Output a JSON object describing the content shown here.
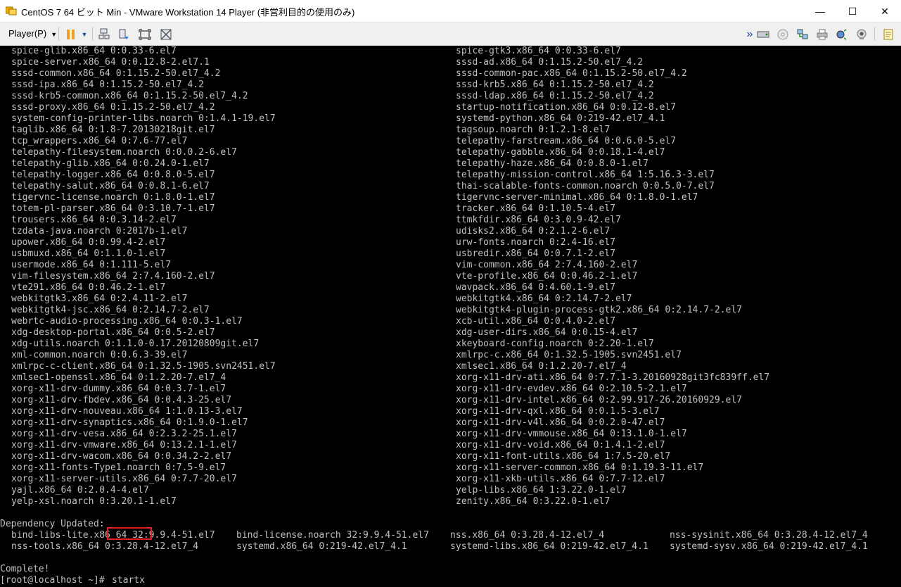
{
  "window": {
    "title": "CentOS 7 64 ビット Min - VMware Workstation 14 Player (非営利目的の使用のみ)",
    "minimize_label": "—",
    "maximize_label": "☐",
    "close_label": "✕"
  },
  "toolbar": {
    "player_menu_label": "Player(P)",
    "player_menu_caret": "▼",
    "pause_caret": "▼",
    "expand_label": "»"
  },
  "terminal": {
    "left_column": [
      "spice-glib.x86_64 0:0.33-6.el7",
      "spice-server.x86_64 0:0.12.8-2.el7.1",
      "sssd-common.x86_64 0:1.15.2-50.el7_4.2",
      "sssd-ipa.x86_64 0:1.15.2-50.el7_4.2",
      "sssd-krb5-common.x86_64 0:1.15.2-50.el7_4.2",
      "sssd-proxy.x86_64 0:1.15.2-50.el7_4.2",
      "system-config-printer-libs.noarch 0:1.4.1-19.el7",
      "taglib.x86_64 0:1.8-7.20130218git.el7",
      "tcp_wrappers.x86_64 0:7.6-77.el7",
      "telepathy-filesystem.noarch 0:0.0.2-6.el7",
      "telepathy-glib.x86_64 0:0.24.0-1.el7",
      "telepathy-logger.x86_64 0:0.8.0-5.el7",
      "telepathy-salut.x86_64 0:0.8.1-6.el7",
      "tigervnc-license.noarch 0:1.8.0-1.el7",
      "totem-pl-parser.x86_64 0:3.10.7-1.el7",
      "trousers.x86_64 0:0.3.14-2.el7",
      "tzdata-java.noarch 0:2017b-1.el7",
      "upower.x86_64 0:0.99.4-2.el7",
      "usbmuxd.x86_64 0:1.1.0-1.el7",
      "usermode.x86_64 0:1.111-5.el7",
      "vim-filesystem.x86_64 2:7.4.160-2.el7",
      "vte291.x86_64 0:0.46.2-1.el7",
      "webkitgtk3.x86_64 0:2.4.11-2.el7",
      "webkitgtk4-jsc.x86_64 0:2.14.7-2.el7",
      "webrtc-audio-processing.x86_64 0:0.3-1.el7",
      "xdg-desktop-portal.x86_64 0:0.5-2.el7",
      "xdg-utils.noarch 0:1.1.0-0.17.20120809git.el7",
      "xml-common.noarch 0:0.6.3-39.el7",
      "xmlrpc-c-client.x86_64 0:1.32.5-1905.svn2451.el7",
      "xmlsec1-openssl.x86_64 0:1.2.20-7.el7_4",
      "xorg-x11-drv-dummy.x86_64 0:0.3.7-1.el7",
      "xorg-x11-drv-fbdev.x86_64 0:0.4.3-25.el7",
      "xorg-x11-drv-nouveau.x86_64 1:1.0.13-3.el7",
      "xorg-x11-drv-synaptics.x86_64 0:1.9.0-1.el7",
      "xorg-x11-drv-vesa.x86_64 0:2.3.2-25.1.el7",
      "xorg-x11-drv-vmware.x86_64 0:13.2.1-1.el7",
      "xorg-x11-drv-wacom.x86_64 0:0.34.2-2.el7",
      "xorg-x11-fonts-Type1.noarch 0:7.5-9.el7",
      "xorg-x11-server-utils.x86_64 0:7.7-20.el7",
      "yajl.x86_64 0:2.0.4-4.el7",
      "yelp-xsl.noarch 0:3.20.1-1.el7"
    ],
    "right_column": [
      "spice-gtk3.x86_64 0:0.33-6.el7",
      "sssd-ad.x86_64 0:1.15.2-50.el7_4.2",
      "sssd-common-pac.x86_64 0:1.15.2-50.el7_4.2",
      "sssd-krb5.x86_64 0:1.15.2-50.el7_4.2",
      "sssd-ldap.x86_64 0:1.15.2-50.el7_4.2",
      "startup-notification.x86_64 0:0.12-8.el7",
      "systemd-python.x86_64 0:219-42.el7_4.1",
      "tagsoup.noarch 0:1.2.1-8.el7",
      "telepathy-farstream.x86_64 0:0.6.0-5.el7",
      "telepathy-gabble.x86_64 0:0.18.1-4.el7",
      "telepathy-haze.x86_64 0:0.8.0-1.el7",
      "telepathy-mission-control.x86_64 1:5.16.3-3.el7",
      "thai-scalable-fonts-common.noarch 0:0.5.0-7.el7",
      "tigervnc-server-minimal.x86_64 0:1.8.0-1.el7",
      "tracker.x86_64 0:1.10.5-4.el7",
      "ttmkfdir.x86_64 0:3.0.9-42.el7",
      "udisks2.x86_64 0:2.1.2-6.el7",
      "urw-fonts.noarch 0:2.4-16.el7",
      "usbredir.x86_64 0:0.7.1-2.el7",
      "vim-common.x86_64 2:7.4.160-2.el7",
      "vte-profile.x86_64 0:0.46.2-1.el7",
      "wavpack.x86_64 0:4.60.1-9.el7",
      "webkitgtk4.x86_64 0:2.14.7-2.el7",
      "webkitgtk4-plugin-process-gtk2.x86_64 0:2.14.7-2.el7",
      "xcb-util.x86_64 0:0.4.0-2.el7",
      "xdg-user-dirs.x86_64 0:0.15-4.el7",
      "xkeyboard-config.noarch 0:2.20-1.el7",
      "xmlrpc-c.x86_64 0:1.32.5-1905.svn2451.el7",
      "xmlsec1.x86_64 0:1.2.20-7.el7_4",
      "xorg-x11-drv-ati.x86_64 0:7.7.1-3.20160928git3fc839ff.el7",
      "xorg-x11-drv-evdev.x86_64 0:2.10.5-2.1.el7",
      "xorg-x11-drv-intel.x86_64 0:2.99.917-26.20160929.el7",
      "xorg-x11-drv-qxl.x86_64 0:0.1.5-3.el7",
      "xorg-x11-drv-v4l.x86_64 0:0.2.0-47.el7",
      "xorg-x11-drv-vmmouse.x86_64 0:13.1.0-1.el7",
      "xorg-x11-drv-void.x86_64 0:1.4.1-2.el7",
      "xorg-x11-font-utils.x86_64 1:7.5-20.el7",
      "xorg-x11-server-common.x86_64 0:1.19.3-11.el7",
      "xorg-x11-xkb-utils.x86_64 0:7.7-12.el7",
      "yelp-libs.x86_64 1:3.22.0-1.el7",
      "zenity.x86_64 0:3.22.0-1.el7"
    ],
    "dependency_header": "Dependency Updated:",
    "dependency_rows": [
      [
        "bind-libs-lite.x86_64 32:9.9.4-51.el7",
        "bind-license.noarch 32:9.9.4-51.el7",
        "nss.x86_64 0:3.28.4-12.el7_4",
        "nss-sysinit.x86_64 0:3.28.4-12.el7_4"
      ],
      [
        "nss-tools.x86_64 0:3.28.4-12.el7_4",
        "systemd.x86_64 0:219-42.el7_4.1",
        "systemd-libs.x86_64 0:219-42.el7_4.1",
        "systemd-sysv.x86_64 0:219-42.el7_4.1"
      ]
    ],
    "complete_text": "Complete!",
    "prompt": "[root@localhost ~]#",
    "command": "startx"
  }
}
